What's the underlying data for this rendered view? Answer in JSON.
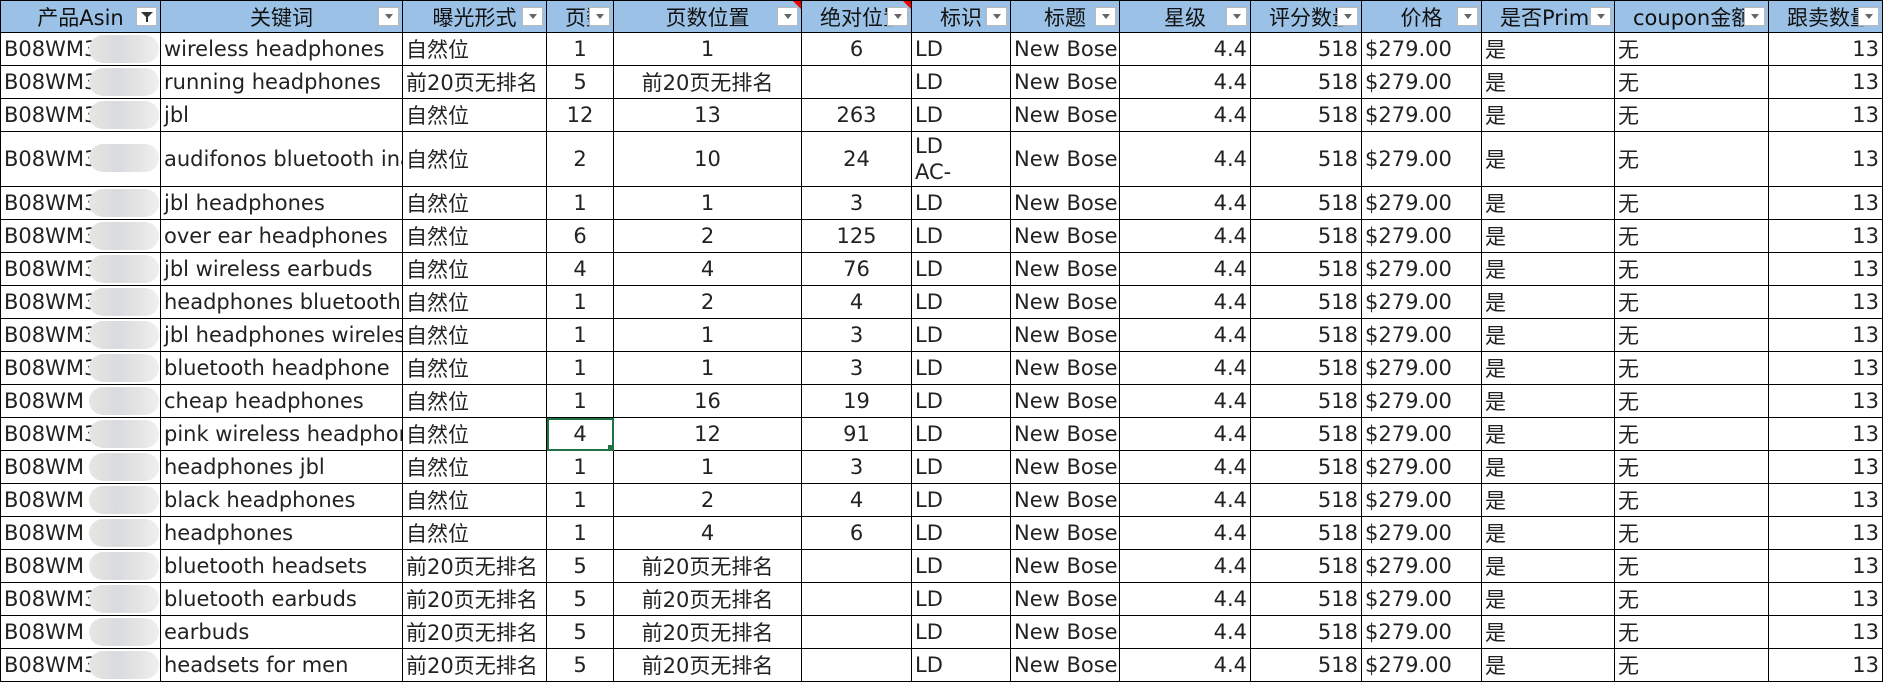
{
  "columns": [
    {
      "label": "产品Asin",
      "filter": "active"
    },
    {
      "label": "关键词",
      "filter": "dropdown"
    },
    {
      "label": "曝光形式",
      "filter": "dropdown"
    },
    {
      "label": "页数",
      "filter": "dropdown"
    },
    {
      "label": "页数位置",
      "filter": "dropdown",
      "comment": true
    },
    {
      "label": "绝对位置",
      "filter": "dropdown",
      "comment": true
    },
    {
      "label": "标识",
      "filter": "dropdown"
    },
    {
      "label": "标题",
      "filter": "dropdown"
    },
    {
      "label": "星级",
      "filter": "dropdown"
    },
    {
      "label": "评分数量",
      "filter": "dropdown"
    },
    {
      "label": "价格",
      "filter": "dropdown"
    },
    {
      "label": "是否Prime",
      "filter": "dropdown"
    },
    {
      "label": "coupon金额",
      "filter": "dropdown"
    },
    {
      "label": "跟卖数量",
      "filter": "dropdown"
    }
  ],
  "rows": [
    {
      "asin": "B08WM3",
      "keyword": "wireless headphones",
      "exposure": "自然位",
      "page": "1",
      "page_pos": "1",
      "abs_pos": "6",
      "mark": "LD",
      "title": "New Bose",
      "rating": "4.4",
      "reviews": "518",
      "price": "$279.00",
      "prime": "是",
      "coupon": "无",
      "sellers": "13"
    },
    {
      "asin": "B08WM3L",
      "keyword": "running headphones",
      "exposure": "前20页无排名",
      "page": "5",
      "page_pos": "前20页无排名",
      "abs_pos": "",
      "mark": "LD",
      "title": "New Bose",
      "rating": "4.4",
      "reviews": "518",
      "price": "$279.00",
      "prime": "是",
      "coupon": "无",
      "sellers": "13"
    },
    {
      "asin": "B08WM3",
      "keyword": "jbl",
      "exposure": "自然位",
      "page": "12",
      "page_pos": "13",
      "abs_pos": "263",
      "mark": "LD",
      "title": "New Bose",
      "rating": "4.4",
      "reviews": "518",
      "price": "$279.00",
      "prime": "是",
      "coupon": "无",
      "sellers": "13"
    },
    {
      "asin": "B08WM3L",
      "keyword": "audifonos bluetooth inalambricos",
      "exposure": "自然位",
      "page": "2",
      "page_pos": "10",
      "abs_pos": "24",
      "mark": "LD",
      "mark2": "AC-",
      "title": "New Bose",
      "rating": "4.4",
      "reviews": "518",
      "price": "$279.00",
      "prime": "是",
      "coupon": "无",
      "sellers": "13",
      "tall": true
    },
    {
      "asin": "B08WM3",
      "keyword": "jbl headphones",
      "exposure": "自然位",
      "page": "1",
      "page_pos": "1",
      "abs_pos": "3",
      "mark": "LD",
      "title": "New Bose",
      "rating": "4.4",
      "reviews": "518",
      "price": "$279.00",
      "prime": "是",
      "coupon": "无",
      "sellers": "13"
    },
    {
      "asin": "B08WM3",
      "keyword": "over ear headphones",
      "exposure": "自然位",
      "page": "6",
      "page_pos": "2",
      "abs_pos": "125",
      "mark": "LD",
      "title": "New Bose",
      "rating": "4.4",
      "reviews": "518",
      "price": "$279.00",
      "prime": "是",
      "coupon": "无",
      "sellers": "13"
    },
    {
      "asin": "B08WM3L",
      "keyword": "jbl wireless earbuds",
      "exposure": "自然位",
      "page": "4",
      "page_pos": "4",
      "abs_pos": "76",
      "mark": "LD",
      "title": "New Bose",
      "rating": "4.4",
      "reviews": "518",
      "price": "$279.00",
      "prime": "是",
      "coupon": "无",
      "sellers": "13"
    },
    {
      "asin": "B08WM3L",
      "keyword": "headphones bluetooth",
      "exposure": "自然位",
      "page": "1",
      "page_pos": "2",
      "abs_pos": "4",
      "mark": "LD",
      "title": "New Bose",
      "rating": "4.4",
      "reviews": "518",
      "price": "$279.00",
      "prime": "是",
      "coupon": "无",
      "sellers": "13"
    },
    {
      "asin": "B08WM3L",
      "keyword": "jbl headphones wireless",
      "exposure": "自然位",
      "page": "1",
      "page_pos": "1",
      "abs_pos": "3",
      "mark": "LD",
      "title": "New Bose",
      "rating": "4.4",
      "reviews": "518",
      "price": "$279.00",
      "prime": "是",
      "coupon": "无",
      "sellers": "13"
    },
    {
      "asin": "B08WM3",
      "keyword": "bluetooth headphone",
      "exposure": "自然位",
      "page": "1",
      "page_pos": "1",
      "abs_pos": "3",
      "mark": "LD",
      "title": "New Bose",
      "rating": "4.4",
      "reviews": "518",
      "price": "$279.00",
      "prime": "是",
      "coupon": "无",
      "sellers": "13"
    },
    {
      "asin": "B08WM",
      "keyword": "cheap headphones",
      "exposure": "自然位",
      "page": "1",
      "page_pos": "16",
      "abs_pos": "19",
      "mark": "LD",
      "title": "New Bose",
      "rating": "4.4",
      "reviews": "518",
      "price": "$279.00",
      "prime": "是",
      "coupon": "无",
      "sellers": "13"
    },
    {
      "asin": "B08WM3",
      "keyword": "pink wireless headphones",
      "exposure": "自然位",
      "page": "4",
      "page_pos": "12",
      "abs_pos": "91",
      "mark": "LD",
      "title": "New Bose",
      "rating": "4.4",
      "reviews": "518",
      "price": "$279.00",
      "prime": "是",
      "coupon": "无",
      "sellers": "13",
      "selected": true
    },
    {
      "asin": "B08WM",
      "keyword": "headphones jbl",
      "exposure": "自然位",
      "page": "1",
      "page_pos": "1",
      "abs_pos": "3",
      "mark": "LD",
      "title": "New Bose",
      "rating": "4.4",
      "reviews": "518",
      "price": "$279.00",
      "prime": "是",
      "coupon": "无",
      "sellers": "13"
    },
    {
      "asin": "B08WM",
      "keyword": "black headphones",
      "exposure": "自然位",
      "page": "1",
      "page_pos": "2",
      "abs_pos": "4",
      "mark": "LD",
      "title": "New Bose",
      "rating": "4.4",
      "reviews": "518",
      "price": "$279.00",
      "prime": "是",
      "coupon": "无",
      "sellers": "13"
    },
    {
      "asin": "B08WM",
      "keyword": "headphones",
      "exposure": "自然位",
      "page": "1",
      "page_pos": "4",
      "abs_pos": "6",
      "mark": "LD",
      "title": "New Bose",
      "rating": "4.4",
      "reviews": "518",
      "price": "$279.00",
      "prime": "是",
      "coupon": "无",
      "sellers": "13"
    },
    {
      "asin": "B08WM",
      "keyword": "bluetooth headsets",
      "exposure": "前20页无排名",
      "page": "5",
      "page_pos": "前20页无排名",
      "abs_pos": "",
      "mark": "LD",
      "title": "New Bose",
      "rating": "4.4",
      "reviews": "518",
      "price": "$279.00",
      "prime": "是",
      "coupon": "无",
      "sellers": "13"
    },
    {
      "asin": "B08WM3",
      "keyword": "bluetooth earbuds",
      "exposure": "前20页无排名",
      "page": "5",
      "page_pos": "前20页无排名",
      "abs_pos": "",
      "mark": "LD",
      "title": "New Bose",
      "rating": "4.4",
      "reviews": "518",
      "price": "$279.00",
      "prime": "是",
      "coupon": "无",
      "sellers": "13"
    },
    {
      "asin": "B08WM",
      "keyword": "earbuds",
      "exposure": "前20页无排名",
      "page": "5",
      "page_pos": "前20页无排名",
      "abs_pos": "",
      "mark": "LD",
      "title": "New Bose",
      "rating": "4.4",
      "reviews": "518",
      "price": "$279.00",
      "prime": "是",
      "coupon": "无",
      "sellers": "13"
    },
    {
      "asin": "B08WM3",
      "keyword": "headsets for men",
      "exposure": "前20页无排名",
      "page": "5",
      "page_pos": "前20页无排名",
      "abs_pos": "",
      "mark": "LD",
      "title": "New Bose",
      "rating": "4.4",
      "reviews": "518",
      "price": "$279.00",
      "prime": "是",
      "coupon": "无",
      "sellers": "13"
    }
  ],
  "colors": {
    "header_bg": "#9bc2e6",
    "selection": "#217346",
    "comment_marker": "#e00000"
  }
}
